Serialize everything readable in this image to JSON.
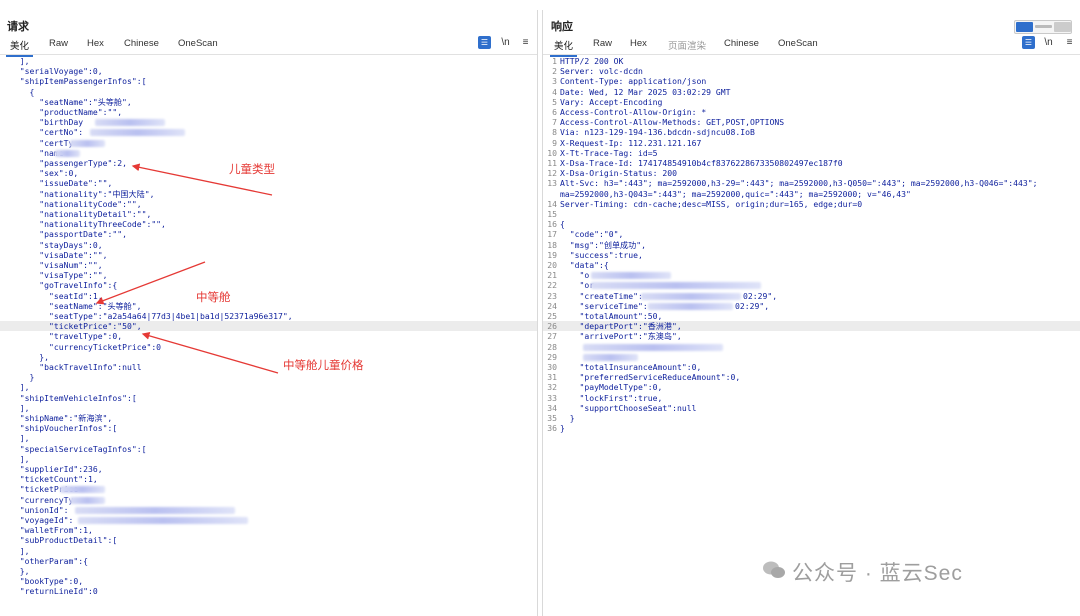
{
  "request": {
    "title": "请求",
    "tabs": [
      "美化",
      "Raw",
      "Hex",
      "Chinese",
      "OneScan"
    ],
    "icons": [
      "wrap-icon",
      "newline-toggle-icon",
      "menu-icon"
    ],
    "newline_label": "\\n",
    "menu_label": "≡"
  },
  "response": {
    "title": "响应",
    "tabs": [
      "美化",
      "Raw",
      "Hex",
      "页面渲染",
      "Chinese",
      "OneScan"
    ],
    "newline_label": "\\n",
    "menu_label": "≡"
  },
  "annotations": {
    "child_type": "儿童类型",
    "middle_class": "中等舱",
    "middle_class_child_price": "中等舱儿童价格"
  },
  "watermark": "公众号 · 蓝云Sec",
  "request_lines": [
    "  ],",
    "  \"serialVoyage\":0,",
    "  \"shipItemPassengerInfos\":[",
    "    {",
    "      \"seatName\":\"头等舱\",",
    "      \"productName\":\"\",",
    "      \"birthDay",
    "      \"certNo\":",
    "      \"certTy",
    "      \"name",
    "      \"passengerType\":2,",
    "      \"sex\":0,",
    "      \"issueDate\":\"\",",
    "      \"nationality\":\"中国大陆\",",
    "      \"nationalityCode\":\"\",",
    "      \"nationalityDetail\":\"\",",
    "      \"nationalityThreeCode\":\"\",",
    "      \"passportDate\":\"\",",
    "      \"stayDays\":0,",
    "      \"visaDate\":\"\",",
    "      \"visaNum\":\"\",",
    "      \"visaType\":\"\",",
    "      \"goTravelInfo\":{",
    "        \"seatId\":1,",
    "        \"seatName\":\"头等舱\",",
    "        \"seatType\":\"a2a54a64|77d3|4be1|ba1d|52371a96e317\",",
    "        \"ticketPrice\":\"50\",",
    "        \"travelType\":0,",
    "        \"currencyTicketPrice\":0",
    "      },",
    "      \"backTravelInfo\":null",
    "    }",
    "  ],",
    "  \"shipItemVehicleInfos\":[",
    "  ],",
    "  \"shipName\":\"新海滨\",",
    "  \"shipVoucherInfos\":[",
    "  ],",
    "  \"specialServiceTagInfos\":[",
    "  ],",
    "  \"supplierId\":236,",
    "  \"ticketCount\":1,",
    "  \"ticketPrice",
    "  \"currencyTy",
    "  \"unionId\":",
    "  \"voyageId\":",
    "  \"walletFrom\":1,",
    "  \"subProductDetail\":[",
    "  ],",
    "  \"otherParam\":{",
    "  },",
    "  \"bookType\":0,",
    "  \"returnLineId\":0"
  ],
  "response_lines": [
    "HTTP/2 200 OK",
    "Server: volc-dcdn",
    "Content-Type: application/json",
    "Date: Wed, 12 Mar 2025 03:02:29 GMT",
    "Vary: Accept-Encoding",
    "Access-Control-Allow-Origin: *",
    "Access-Control-Allow-Methods: GET,POST,OPTIONS",
    "Via: n123-129-194-136.bdcdn-sdjncu08.IoB",
    "X-Request-Ip: 112.231.121.167",
    "X-Tt-Trace-Tag: id=5",
    "X-Dsa-Trace-Id: 174174854910b4cf8376228673350802497ec187f0",
    "X-Dsa-Origin-Status: 200",
    "Alt-Svc: h3=\":443\"; ma=2592000,h3-29=\":443\"; ma=2592000,h3-Q050=\":443\"; ma=2592000,h3-Q046=\":443\";",
    "ma=2592000,h3-Q043=\":443\"; ma=2592000,quic=\":443\"; ma=2592000; v=\"46,43\"",
    "Server-Timing: cdn-cache;desc=MISS, origin;dur=165, edge;dur=0",
    "",
    "{",
    "  \"code\":\"0\",",
    "  \"msg\":\"创单成功\",",
    "  \"success\":true,",
    "  \"data\":{",
    "    \"o",
    "    \"or",
    "    \"createTime\":",
    "    \"serviceTime\":",
    "    \"totalAmount\":50,",
    "    \"departPort\":\"香洲港\",",
    "    \"arrivePort\":\"东澳岛\",",
    "    ",
    "    ",
    "    \"totalInsuranceAmount\":0,",
    "    \"preferredServiceReduceAmount\":0,",
    "    \"payModelType\":0,",
    "    \"lockFirst\":true,",
    "    \"supportChooseSeat\":null",
    "  }",
    "}"
  ],
  "response_line_numbers": [
    "1",
    "2",
    "3",
    "4",
    "5",
    "6",
    "7",
    "8",
    "9",
    "10",
    "11",
    "12",
    "13",
    "",
    "14",
    "15",
    "16",
    "17",
    "18",
    "19",
    "20",
    "21",
    "22",
    "23",
    "24",
    "25",
    "26",
    "27",
    "28",
    "29",
    "30",
    "31",
    "32",
    "33",
    "34",
    "35",
    "36"
  ],
  "response_time_fragments": [
    "02:29\",",
    "02:29\","
  ]
}
